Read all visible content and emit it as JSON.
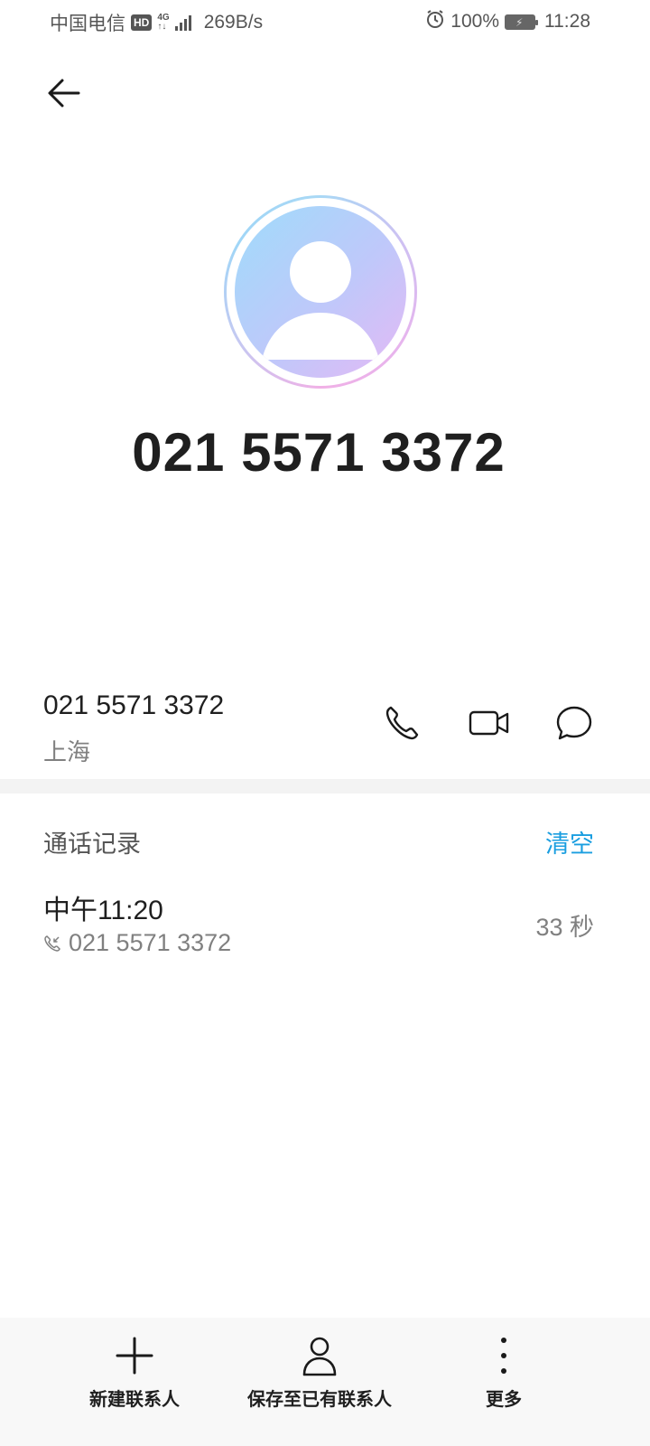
{
  "status_bar": {
    "carrier": "中国电信",
    "hd": "HD",
    "net_type_top": "4G",
    "net_type_bottom": "↑↓",
    "speed": "269B/s",
    "battery": "100%",
    "time": "11:28"
  },
  "contact": {
    "display_number": "021 5571 3372"
  },
  "number_row": {
    "number": "021 5571 3372",
    "location": "上海"
  },
  "call_log": {
    "title": "通话记录",
    "clear_label": "清空",
    "items": [
      {
        "time": "中午11:20",
        "number": "021 5571 3372",
        "duration": "33 秒"
      }
    ]
  },
  "bottom_bar": {
    "new_contact": "新建联系人",
    "save_existing": "保存至已有联系人",
    "more": "更多"
  },
  "colors": {
    "accent": "#1a9ee0",
    "text_primary": "#1f1f1f",
    "text_secondary": "#808080"
  }
}
